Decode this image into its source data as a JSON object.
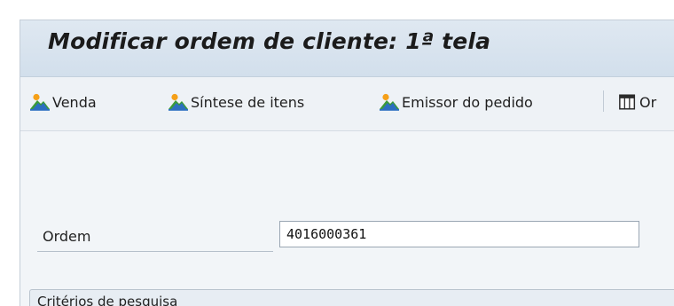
{
  "header": {
    "title": "Modificar ordem de cliente: 1ª tela"
  },
  "toolbar": {
    "buttons": [
      {
        "label": "Venda",
        "icon": "mountain-icon"
      },
      {
        "label": "Síntese de itens",
        "icon": "mountain-icon"
      },
      {
        "label": "Emissor do pedido",
        "icon": "mountain-icon"
      },
      {
        "label": "Or",
        "icon": "table-grid-icon"
      }
    ]
  },
  "form": {
    "order_label": "Ordem",
    "order_value": "4016000361"
  },
  "search_group": {
    "title": "Critérios de pesquisa"
  },
  "colors": {
    "title_bar": "#d6e2ee",
    "panel": "#f2f5f8",
    "toolbar": "#eef2f6"
  }
}
